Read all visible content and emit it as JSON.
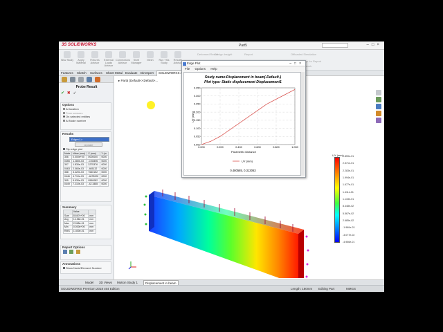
{
  "app": {
    "logo_prefix": "3S",
    "logo_text": "SOLIDWORKS",
    "document_title": "Part5",
    "search_placeholder": "Search"
  },
  "ribbon": {
    "buttons": [
      "New Study",
      "Apply Material",
      "Fixtures Advisor",
      "External Loads Advisor",
      "Connections Advisor",
      "Shell Manager",
      "Mesh",
      "Run This Study",
      "Results Advisor"
    ],
    "right_items": [
      "Deformed Result",
      "Compare Results",
      "Design Insight",
      "Report",
      "Plot Tools",
      "Offloaded Simulation",
      "Include Image for Report",
      "Manage Network"
    ]
  },
  "command_tabs": [
    "Features",
    "Sketch",
    "Surfaces",
    "Sheet Metal",
    "Evaluate",
    "DimXpert",
    "SOLIDWORKS Ad"
  ],
  "property_manager": {
    "title": "Probe Result",
    "options_header": "Options",
    "options": [
      {
        "label": "At location",
        "selected": false
      },
      {
        "label": "From sensors",
        "selected": false
      },
      {
        "label": "On selected entities",
        "selected": true
      },
      {
        "label": "At Node number",
        "selected": false
      }
    ],
    "results_header": "Results",
    "selection": "Edge<1>",
    "update_label": "Update",
    "flip_label": "Flip edge plot",
    "table_headers": [
      "Node",
      "Value (mm)",
      "X (mm)",
      "Y (m"
    ],
    "table_rows": [
      [
        "306",
        "0.000e+00",
        "0000000",
        "0000"
      ],
      [
        "0455",
        "1.280e-03",
        "-0.35496",
        "0000"
      ],
      [
        "307",
        "1.830e-03",
        "3275376",
        "0000"
      ],
      [
        "0463",
        "2.060e-03",
        "-465132",
        "0000"
      ],
      [
        "368",
        "3.420e-03",
        "7640152",
        "0000"
      ],
      [
        "0446",
        "4.710e-03",
        "-4675000",
        "0000"
      ],
      [
        "305",
        "5.930e-03",
        "9550082",
        "0000"
      ],
      [
        "0449",
        "7.210e-03",
        "-42.3485",
        "0000"
      ]
    ],
    "summary_header": "Summary",
    "summary_headers": [
      "",
      "Value",
      ""
    ],
    "summary_rows": [
      [
        "Sum",
        "8.667e+00",
        "mm"
      ],
      [
        "Avg",
        "1.156e-01",
        "mm"
      ],
      [
        "Max",
        "2.065e-01",
        "mm"
      ],
      [
        "Min",
        "0.000e+00",
        "mm"
      ],
      [
        "RMS",
        "1.400e-01",
        "mm"
      ]
    ],
    "report_header": "Report Options",
    "annotations_header": "Annotations",
    "annotation_option": "Show Node/Element Number"
  },
  "graphics": {
    "tree_label": "Part5 (Default<<Default>..."
  },
  "legend": {
    "title": "UY (mm)",
    "labels": [
      "2.859e-01",
      "2.571e-01",
      "2.283e-01",
      "1.994e-01",
      "1.677e-01",
      "1.411e-01",
      "1.133e-01",
      "8.448e-02",
      "5.567e-02",
      "2.685e-02",
      "-1.960e-03",
      "-3.077e-02",
      "-4.956e-01"
    ]
  },
  "edge_plot": {
    "window_title": "Edge Plot",
    "menu": [
      "File",
      "Options",
      "Help"
    ],
    "study_line": "Study name:Displacement in beam(-Default-)",
    "plot_type_line": "Plot type: Static displacement Displacement1",
    "xlabel": "Parametric Distance",
    "ylabel": "UY (mm)",
    "legend_entry": "UY (mm)",
    "readout": "0.480585, 0.313063",
    "chart_data": {
      "type": "line",
      "x": [
        0.0,
        0.1,
        0.2,
        0.3,
        0.4,
        0.5,
        0.6,
        0.7,
        0.8,
        0.9,
        1.0
      ],
      "series": [
        {
          "name": "UY (mm)",
          "values": [
            0.0,
            0.02,
            0.05,
            0.09,
            0.13,
            0.17,
            0.21,
            0.25,
            0.28,
            0.31,
            0.34
          ],
          "color": "#d9534f"
        }
      ],
      "xlim": [
        0.0,
        1.0
      ],
      "ylim": [
        0.0,
        0.35
      ],
      "xticks": [
        "0.000",
        "0.200",
        "0.400",
        "0.600",
        "0.800",
        "1.000"
      ],
      "yticks": [
        "0.000",
        "0.050",
        "0.100",
        "0.150",
        "0.200",
        "0.250",
        "0.300",
        "0.350"
      ],
      "grid": true
    }
  },
  "bottom_tabs": [
    "Model",
    "3D Views",
    "Motion Study 1",
    "Displacement in beam"
  ],
  "status": {
    "left": "SOLIDWORKS Premium 2018 x64 Edition",
    "length": "Length: 180mm",
    "mode": "Editing Part",
    "units": "MMGS"
  }
}
